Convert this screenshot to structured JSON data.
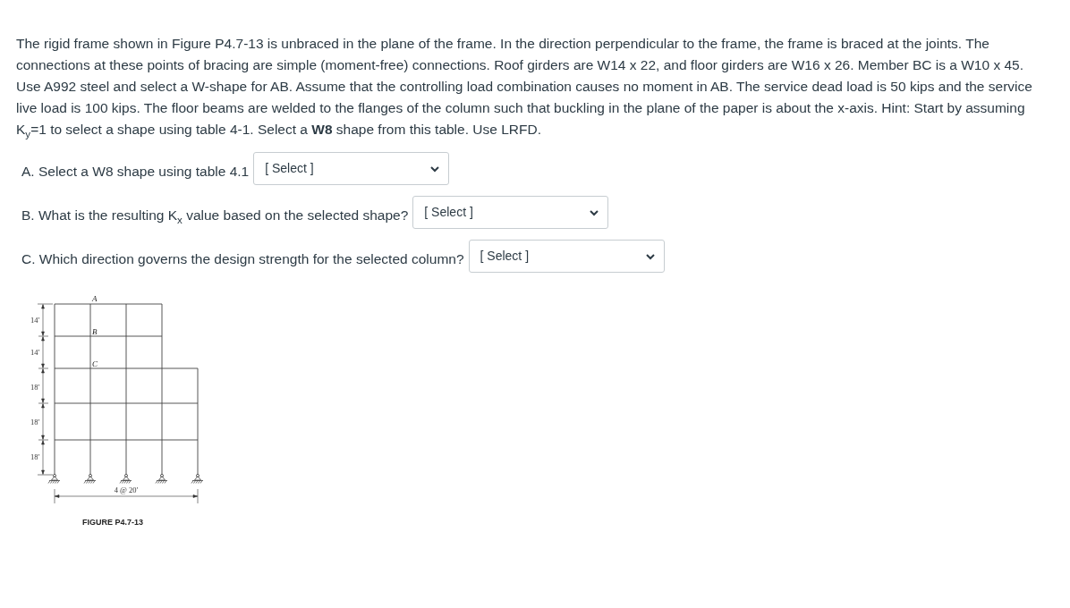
{
  "problem_text": "The rigid frame shown in Figure P4.7-13 is unbraced in the plane of the frame. In the direction perpendicular to the frame, the frame is braced at the joints. The connections at these points of bracing are simple (moment-free) connections. Roof girders are W14 x 22, and floor girders are W16 x 26. Member BC is a W10 x 45. Use A992 steel and select a W-shape for AB. Assume that the controlling load combination causes no moment in AB. The service dead load is 50 kips and the service live load is 100 kips. The floor beams are welded to the flanges of the column such that buckling in the plane of the paper is about the x-axis. Hint: Start by assuming K$_{y}$=1 to select a shape using table 4-1. Select a **W8** shape from this table. Use LRFD.",
  "questions": [
    {
      "prompt": "A. Select a W8 shape using table 4.1",
      "dropdown": "[ Select ]"
    },
    {
      "prompt": "B. What is the resulting K$_{x}$ value based on the selected shape?",
      "dropdown": "[ Select ]"
    },
    {
      "prompt": "C. Which direction governs the design strength for the selected column?",
      "dropdown": "[ Select ]"
    }
  ],
  "figure": {
    "point_labels": [
      "A",
      "B",
      "C"
    ],
    "story_heights": [
      "14′",
      "14′",
      "18′",
      "18′",
      "18′"
    ],
    "bay_dimension": "4 @ 20′",
    "caption": "FIGURE P4.7-13"
  }
}
